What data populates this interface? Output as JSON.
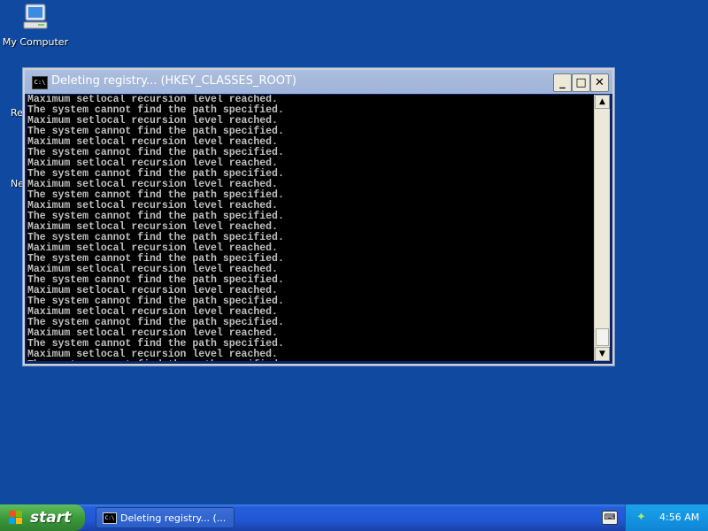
{
  "desktop": {
    "icons": [
      {
        "label": "My Computer",
        "icon": "computer-icon"
      }
    ],
    "partial_labels": [
      "Re",
      "Ne"
    ]
  },
  "window": {
    "title": "Deleting registry... (HKEY_CLASSES_ROOT)",
    "icon_text": "C:\\",
    "buttons": {
      "minimize": "_",
      "maximize": "□",
      "close": "✕"
    },
    "console_lines": [
      "Maximum setlocal recursion level reached.",
      "The system cannot find the path specified.",
      "Maximum setlocal recursion level reached.",
      "The system cannot find the path specified.",
      "Maximum setlocal recursion level reached.",
      "The system cannot find the path specified.",
      "Maximum setlocal recursion level reached.",
      "The system cannot find the path specified.",
      "Maximum setlocal recursion level reached.",
      "The system cannot find the path specified.",
      "Maximum setlocal recursion level reached.",
      "The system cannot find the path specified.",
      "Maximum setlocal recursion level reached.",
      "The system cannot find the path specified.",
      "Maximum setlocal recursion level reached.",
      "The system cannot find the path specified.",
      "Maximum setlocal recursion level reached.",
      "The system cannot find the path specified.",
      "Maximum setlocal recursion level reached.",
      "The system cannot find the path specified.",
      "Maximum setlocal recursion level reached.",
      "The system cannot find the path specified.",
      "Maximum setlocal recursion level reached.",
      "The system cannot find the path specified.",
      "Maximum setlocal recursion level reached.",
      "The system cannot find the path specified."
    ]
  },
  "taskbar": {
    "start_label": "start",
    "task_label": "Deleting registry... (...",
    "clock": "4:56 AM"
  },
  "colors": {
    "desktop": "#0f4aa0",
    "console_bg": "#000000",
    "console_text": "#c0c0c0",
    "taskbar": "#245edb",
    "start": "#3c9a3c",
    "tray": "#0f86d6"
  }
}
